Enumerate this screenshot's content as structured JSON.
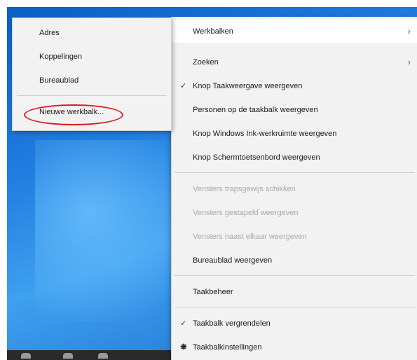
{
  "context_menu": {
    "items": [
      {
        "label": "Werkbalken",
        "submenu": true,
        "hover": true
      },
      {
        "label": "Zoeken",
        "submenu": true
      },
      {
        "label": "Knop Taakweergave weergeven",
        "checked": true
      },
      {
        "label": "Personen op de taakbalk weergeven"
      },
      {
        "label": "Knop Windows Ink-werkruimte weergeven"
      },
      {
        "label": "Knop Schermtoetsenbord weergeven"
      },
      {
        "label": "Vensters trapsgewijs schikken",
        "disabled": true
      },
      {
        "label": "Vensters gestapeld weergeven",
        "disabled": true
      },
      {
        "label": "Vensters naast elkaar weergeven",
        "disabled": true
      },
      {
        "label": "Bureaublad weergeven"
      },
      {
        "label": "Taakbeheer"
      },
      {
        "label": "Taakbalk vergrendelen",
        "checked": true
      },
      {
        "label": "Taakbalkinstellingen",
        "icon": "gear-icon"
      }
    ]
  },
  "toolbars_submenu": {
    "items": [
      {
        "label": "Adres"
      },
      {
        "label": "Koppelingen"
      },
      {
        "label": "Bureaublad"
      },
      {
        "label": "Nieuwe werkbalk...",
        "circled": true
      }
    ]
  },
  "icons": {
    "chevron": "›",
    "check": "✓"
  },
  "colors": {
    "menu_background": "#f2f2f2",
    "hover_background": "#ffffff",
    "disabled_text": "#a8a8a8",
    "annotation_red": "#d62020",
    "desktop_blue": "#1f7ee0"
  }
}
